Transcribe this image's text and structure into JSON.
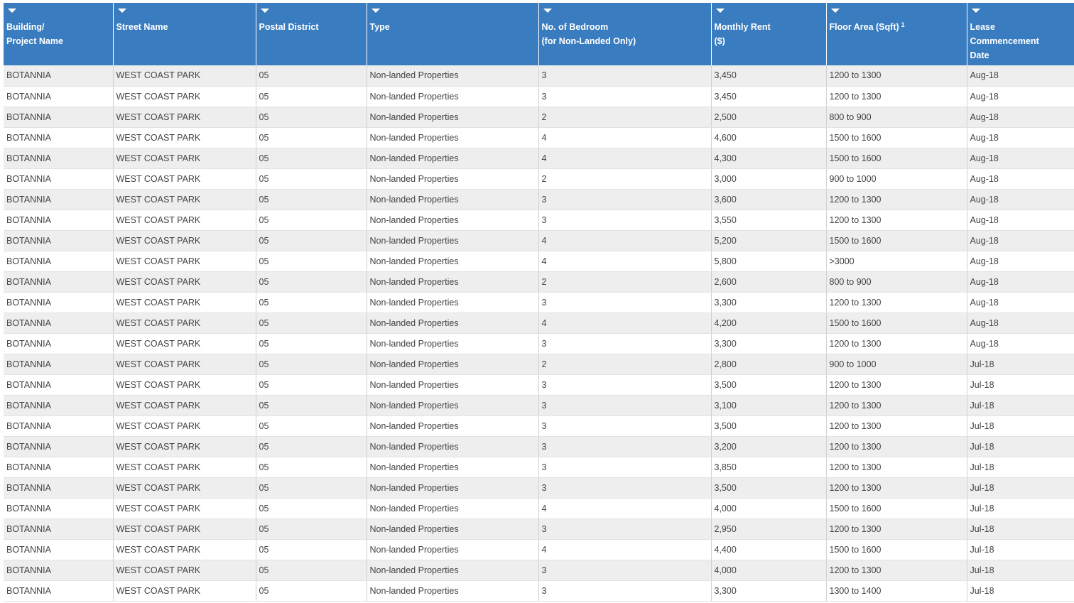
{
  "colors": {
    "header_bg": "#3a7cc0",
    "header_text": "#ffffff",
    "row_alt": "#eeeeee",
    "row_plain": "#ffffff"
  },
  "header": {
    "columns": [
      {
        "label": "Building/\nProject Name",
        "icon": "filter-dropdown-icon"
      },
      {
        "label": "Street Name",
        "icon": "filter-dropdown-icon"
      },
      {
        "label": "Postal District",
        "icon": "filter-dropdown-icon"
      },
      {
        "label": "Type",
        "icon": "filter-dropdown-icon"
      },
      {
        "label": "No. of Bedroom\n(for Non-Landed Only)",
        "icon": "filter-dropdown-icon"
      },
      {
        "label": "Monthly Rent\n($)",
        "icon": "filter-dropdown-icon"
      },
      {
        "label": "Floor Area (Sqft)",
        "sup": "1",
        "icon": "filter-dropdown-icon"
      },
      {
        "label": "Lease\nCommencement\nDate",
        "icon": "filter-dropdown-icon"
      }
    ]
  },
  "rows": [
    [
      "BOTANNIA",
      "WEST COAST PARK",
      "05",
      "Non-landed Properties",
      "3",
      "3,450",
      "1200 to 1300",
      "Aug-18"
    ],
    [
      "BOTANNIA",
      "WEST COAST PARK",
      "05",
      "Non-landed Properties",
      "3",
      "3,450",
      "1200 to 1300",
      "Aug-18"
    ],
    [
      "BOTANNIA",
      "WEST COAST PARK",
      "05",
      "Non-landed Properties",
      "2",
      "2,500",
      "800 to 900",
      "Aug-18"
    ],
    [
      "BOTANNIA",
      "WEST COAST PARK",
      "05",
      "Non-landed Properties",
      "4",
      "4,600",
      "1500 to 1600",
      "Aug-18"
    ],
    [
      "BOTANNIA",
      "WEST COAST PARK",
      "05",
      "Non-landed Properties",
      "4",
      "4,300",
      "1500 to 1600",
      "Aug-18"
    ],
    [
      "BOTANNIA",
      "WEST COAST PARK",
      "05",
      "Non-landed Properties",
      "2",
      "3,000",
      "900 to 1000",
      "Aug-18"
    ],
    [
      "BOTANNIA",
      "WEST COAST PARK",
      "05",
      "Non-landed Properties",
      "3",
      "3,600",
      "1200 to 1300",
      "Aug-18"
    ],
    [
      "BOTANNIA",
      "WEST COAST PARK",
      "05",
      "Non-landed Properties",
      "3",
      "3,550",
      "1200 to 1300",
      "Aug-18"
    ],
    [
      "BOTANNIA",
      "WEST COAST PARK",
      "05",
      "Non-landed Properties",
      "4",
      "5,200",
      "1500 to 1600",
      "Aug-18"
    ],
    [
      "BOTANNIA",
      "WEST COAST PARK",
      "05",
      "Non-landed Properties",
      "4",
      "5,800",
      ">3000",
      "Aug-18"
    ],
    [
      "BOTANNIA",
      "WEST COAST PARK",
      "05",
      "Non-landed Properties",
      "2",
      "2,600",
      "800 to 900",
      "Aug-18"
    ],
    [
      "BOTANNIA",
      "WEST COAST PARK",
      "05",
      "Non-landed Properties",
      "3",
      "3,300",
      "1200 to 1300",
      "Aug-18"
    ],
    [
      "BOTANNIA",
      "WEST COAST PARK",
      "05",
      "Non-landed Properties",
      "4",
      "4,200",
      "1500 to 1600",
      "Aug-18"
    ],
    [
      "BOTANNIA",
      "WEST COAST PARK",
      "05",
      "Non-landed Properties",
      "3",
      "3,300",
      "1200 to 1300",
      "Aug-18"
    ],
    [
      "BOTANNIA",
      "WEST COAST PARK",
      "05",
      "Non-landed Properties",
      "2",
      "2,800",
      "900 to 1000",
      "Jul-18"
    ],
    [
      "BOTANNIA",
      "WEST COAST PARK",
      "05",
      "Non-landed Properties",
      "3",
      "3,500",
      "1200 to 1300",
      "Jul-18"
    ],
    [
      "BOTANNIA",
      "WEST COAST PARK",
      "05",
      "Non-landed Properties",
      "3",
      "3,100",
      "1200 to 1300",
      "Jul-18"
    ],
    [
      "BOTANNIA",
      "WEST COAST PARK",
      "05",
      "Non-landed Properties",
      "3",
      "3,500",
      "1200 to 1300",
      "Jul-18"
    ],
    [
      "BOTANNIA",
      "WEST COAST PARK",
      "05",
      "Non-landed Properties",
      "3",
      "3,200",
      "1200 to 1300",
      "Jul-18"
    ],
    [
      "BOTANNIA",
      "WEST COAST PARK",
      "05",
      "Non-landed Properties",
      "3",
      "3,850",
      "1200 to 1300",
      "Jul-18"
    ],
    [
      "BOTANNIA",
      "WEST COAST PARK",
      "05",
      "Non-landed Properties",
      "3",
      "3,500",
      "1200 to 1300",
      "Jul-18"
    ],
    [
      "BOTANNIA",
      "WEST COAST PARK",
      "05",
      "Non-landed Properties",
      "4",
      "4,000",
      "1500 to 1600",
      "Jul-18"
    ],
    [
      "BOTANNIA",
      "WEST COAST PARK",
      "05",
      "Non-landed Properties",
      "3",
      "2,950",
      "1200 to 1300",
      "Jul-18"
    ],
    [
      "BOTANNIA",
      "WEST COAST PARK",
      "05",
      "Non-landed Properties",
      "4",
      "4,400",
      "1500 to 1600",
      "Jul-18"
    ],
    [
      "BOTANNIA",
      "WEST COAST PARK",
      "05",
      "Non-landed Properties",
      "3",
      "4,000",
      "1200 to 1300",
      "Jul-18"
    ],
    [
      "BOTANNIA",
      "WEST COAST PARK",
      "05",
      "Non-landed Properties",
      "3",
      "3,300",
      "1300 to 1400",
      "Jul-18"
    ]
  ]
}
